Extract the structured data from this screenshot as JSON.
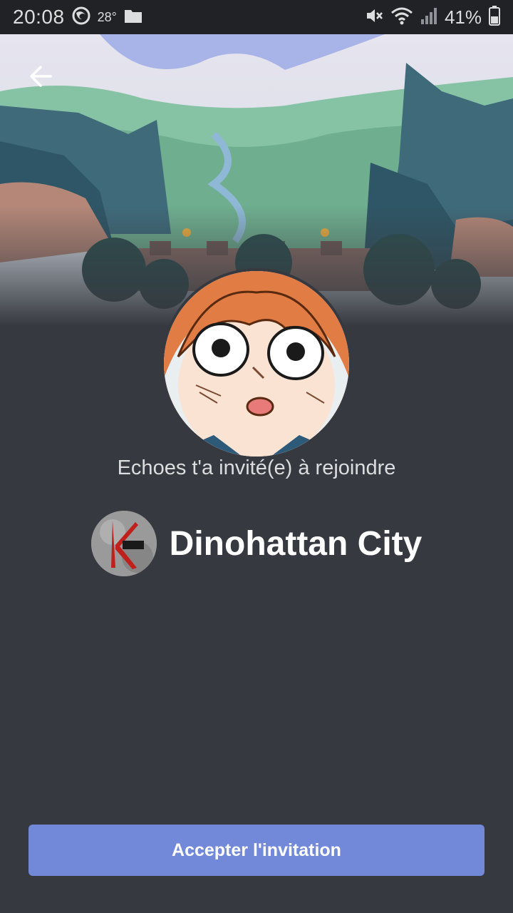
{
  "status_bar": {
    "time": "20:08",
    "temperature": "28°",
    "battery": "41%",
    "icons": [
      "firefox-icon",
      "folder-icon",
      "mute-icon",
      "wifi-icon",
      "signal-icon",
      "battery-icon"
    ]
  },
  "invite": {
    "inviter_text": "Echoes t'a invité(e) à rejoindre",
    "server_name": "Dinohattan City",
    "accept_label": "Accepter l'invitation"
  },
  "colors": {
    "background": "#36393f",
    "status_bar": "#202225",
    "accent": "#7289da",
    "text_muted": "#dcddde"
  }
}
